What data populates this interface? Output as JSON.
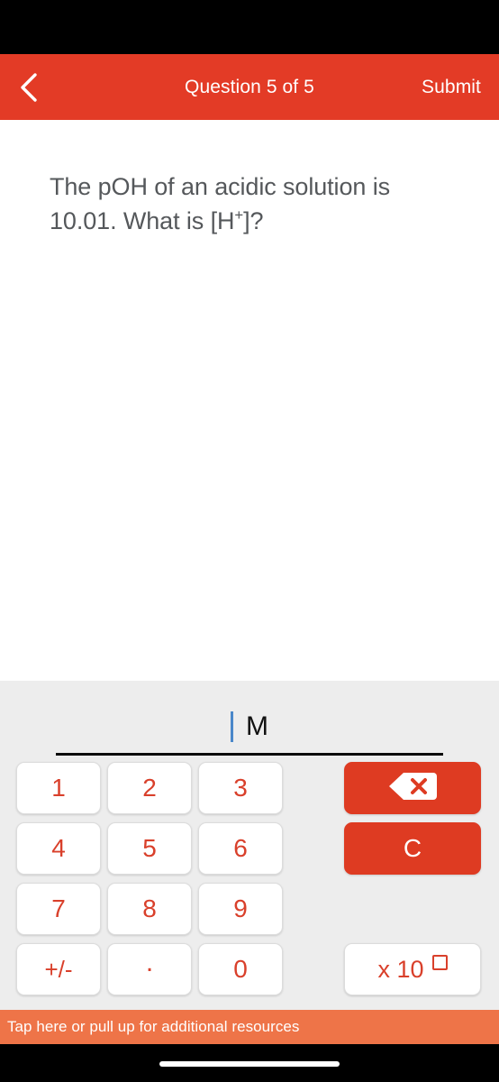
{
  "header": {
    "back_icon": "chevron-left-icon",
    "title": "Question 5 of 5",
    "submit_label": "Submit",
    "background_color": "#E33B26",
    "text_color": "#FFFFFF"
  },
  "question": {
    "line1": "The pOH of an acidic solution is",
    "line2_prefix": "10.01. What is [H",
    "line2_sup": "+",
    "line2_suffix": "]?",
    "text_color": "#55585B"
  },
  "answer": {
    "value": "",
    "caret_visible": true,
    "caret_color": "#4A87C9",
    "unit": "M",
    "underline_color": "#0B0B0B"
  },
  "keypad": {
    "background_color": "#EDEDED",
    "key_text_color": "#D9402B",
    "keys": [
      {
        "label": "1",
        "name": "key-1"
      },
      {
        "label": "2",
        "name": "key-2"
      },
      {
        "label": "3",
        "name": "key-3"
      },
      {
        "label": "4",
        "name": "key-4"
      },
      {
        "label": "5",
        "name": "key-5"
      },
      {
        "label": "6",
        "name": "key-6"
      },
      {
        "label": "7",
        "name": "key-7"
      },
      {
        "label": "8",
        "name": "key-8"
      },
      {
        "label": "9",
        "name": "key-9"
      },
      {
        "label": "+/-",
        "name": "key-plus-minus"
      },
      {
        "label": ".",
        "name": "key-decimal"
      },
      {
        "label": "0",
        "name": "key-0"
      }
    ],
    "actions": {
      "backspace_icon": "backspace-icon",
      "clear_label": "C",
      "exponent_label": "x 10",
      "exponent_placeholder": "□",
      "action_color": "#DE3B22"
    }
  },
  "resources": {
    "label": "Tap here or pull up for additional resources",
    "background_color": "#EE7448",
    "text_color": "#FFFFFF"
  }
}
